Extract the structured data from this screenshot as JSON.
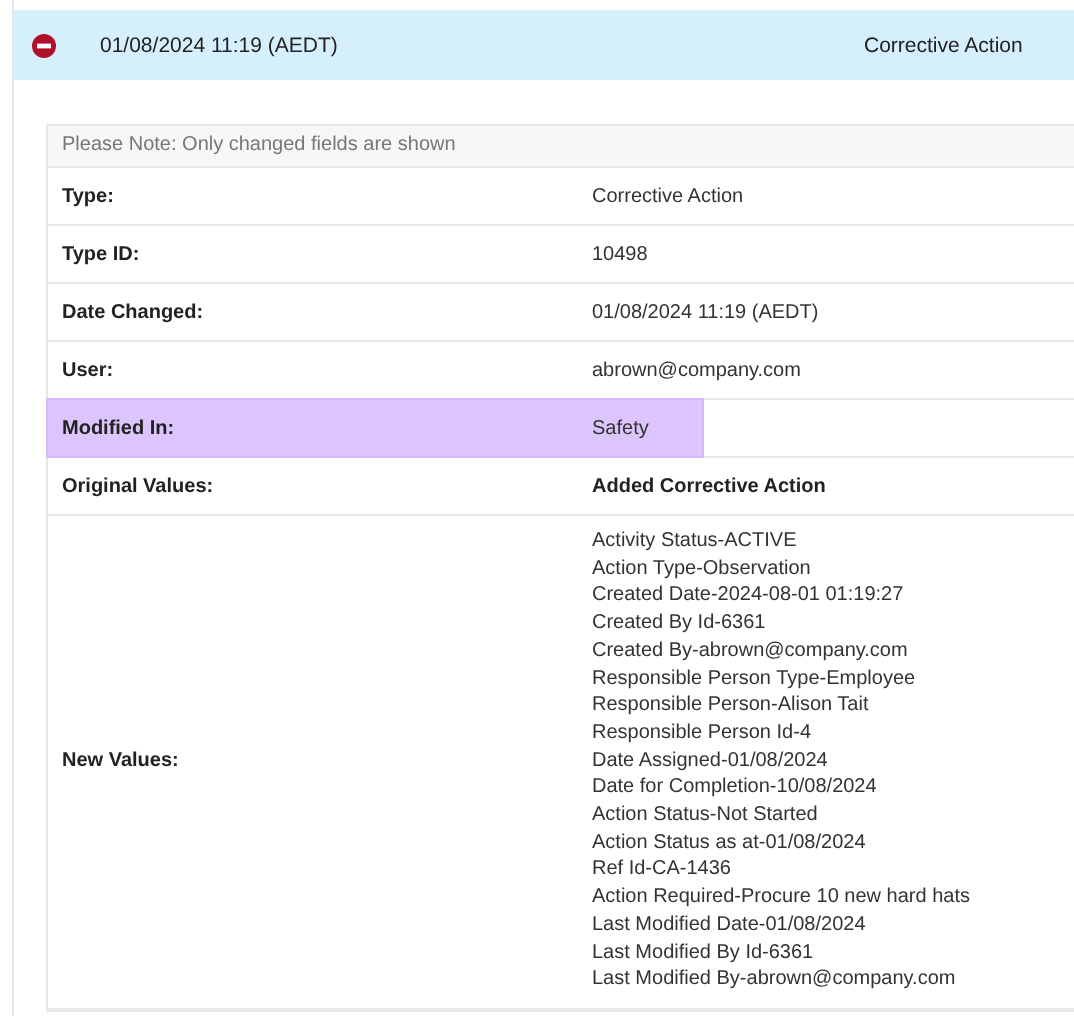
{
  "header": {
    "expanded": true,
    "date": "01/08/2024 11:19 (AEDT)",
    "type": "Corrective Action"
  },
  "note": "Please Note: Only changed fields are shown",
  "rows": [
    {
      "label": "Type:",
      "kind": "text",
      "highlighted": false,
      "value": "Corrective Action"
    },
    {
      "label": "Type ID:",
      "kind": "text",
      "highlighted": false,
      "value": "10498"
    },
    {
      "label": "Date Changed:",
      "kind": "text",
      "highlighted": false,
      "value": "01/08/2024 11:19 (AEDT)"
    },
    {
      "label": "User:",
      "kind": "text",
      "highlighted": false,
      "value": "abrown@company.com"
    },
    {
      "label": "Modified In:",
      "kind": "text",
      "highlighted": true,
      "value": "Safety"
    },
    {
      "label": "Original Values:",
      "kind": "bold",
      "highlighted": false,
      "value": "Added Corrective Action"
    },
    {
      "label": "New Values:",
      "kind": "list",
      "highlighted": false,
      "lines": [
        "Activity Status-ACTIVE",
        "Action Type-Observation",
        "Created Date-2024-08-01 01:19:27",
        "Created By Id-6361",
        "Created By-abrown@company.com",
        "Responsible Person Type-Employee",
        "Responsible Person-Alison Tait",
        "Responsible Person Id-4",
        "Date Assigned-01/08/2024",
        "Date for Completion-10/08/2024",
        "Action Status-Not Started",
        "Action Status as at-01/08/2024",
        "Ref Id-CA-1436",
        "Action Required-Procure 10 new hard hats",
        "Last Modified Date-01/08/2024",
        "Last Modified By Id-6361",
        "Last Modified By-abrown@company.com"
      ]
    }
  ]
}
